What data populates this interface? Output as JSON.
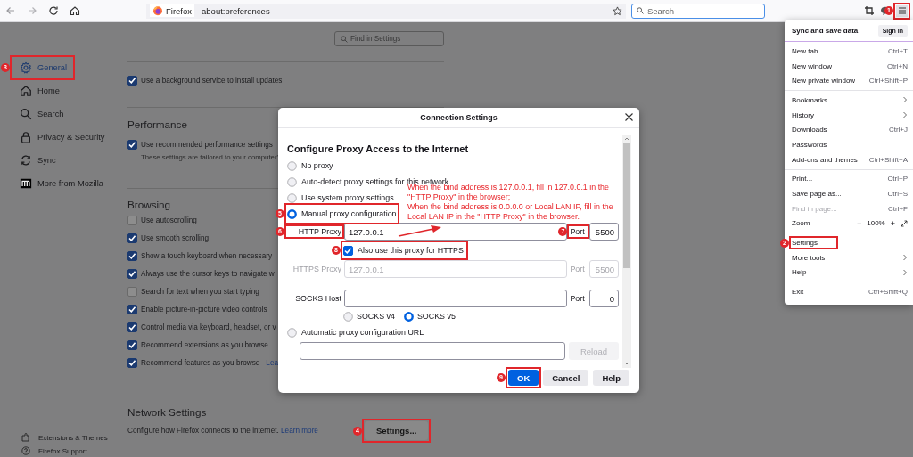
{
  "toolbar": {
    "site_label": "Firefox",
    "url": "about:preferences",
    "search": {
      "placeholder": "Search"
    },
    "menu_button": {
      "marker": "1"
    }
  },
  "find_field": {
    "placeholder": "Find in Settings"
  },
  "sidebar": {
    "items": [
      {
        "label": "General",
        "selected": true,
        "marker": "3"
      },
      {
        "label": "Home",
        "selected": false
      },
      {
        "label": "Search",
        "selected": false
      },
      {
        "label": "Privacy & Security",
        "selected": false
      },
      {
        "label": "Sync",
        "selected": false
      },
      {
        "label": "More from Mozilla",
        "selected": false
      }
    ],
    "footer_links": [
      "Extensions & Themes",
      "Firefox Support"
    ]
  },
  "content": {
    "update_option": {
      "label": "Use a background service to install updates",
      "checked": true
    },
    "performance": {
      "heading": "Performance",
      "option": {
        "label": "Use recommended performance settings",
        "checked": true
      },
      "note": "These settings are tailored to your computer'"
    },
    "browsing": {
      "heading": "Browsing",
      "options": [
        {
          "label": "Use autoscrolling",
          "checked": false
        },
        {
          "label": "Use smooth scrolling",
          "checked": true
        },
        {
          "label": "Show a touch keyboard when necessary",
          "checked": true
        },
        {
          "label": "Always use the cursor keys to navigate w",
          "checked": true
        },
        {
          "label": "Search for text when you start typing",
          "checked": false
        },
        {
          "label": "Enable picture-in-picture video controls",
          "checked": true
        },
        {
          "label": "Control media via keyboard, headset, or v",
          "checked": true
        },
        {
          "label": "Recommend extensions as you browse",
          "checked": true
        },
        {
          "label": "Recommend features as you browse",
          "checked": true,
          "link": "Lea"
        }
      ]
    },
    "network": {
      "heading": "Network Settings",
      "description": "Configure how Firefox connects to the internet.",
      "link": "Learn more",
      "button": {
        "label": "Settings...",
        "marker": "4"
      }
    }
  },
  "dialog": {
    "title": "Connection Settings",
    "heading": "Configure Proxy Access to the Internet",
    "proxy_modes": [
      {
        "label": "No proxy",
        "selected": false
      },
      {
        "label": "Auto-detect proxy settings for this network",
        "selected": false
      },
      {
        "label": "Use system proxy settings",
        "selected": false
      },
      {
        "label": "Manual proxy configuration",
        "selected": true,
        "marker": "5"
      }
    ],
    "http_proxy": {
      "label": "HTTP Proxy",
      "value": "127.0.0.1",
      "marker": "6",
      "port_label": "Port",
      "port": "5500",
      "port_marker": "7"
    },
    "https_checkbox": {
      "label": "Also use this proxy for HTTPS",
      "checked": true,
      "marker": "8"
    },
    "https_proxy": {
      "label": "HTTPS Proxy",
      "value": "127.0.0.1",
      "port_label": "Port",
      "port": "5500",
      "disabled": true
    },
    "socks": {
      "label": "SOCKS Host",
      "port_label": "Port",
      "port": "0",
      "versions": [
        {
          "label": "SOCKS v4",
          "selected": false
        },
        {
          "label": "SOCKS v5",
          "selected": true
        }
      ]
    },
    "auto_url": {
      "label": "Automatic proxy configuration URL",
      "selected": false,
      "reload": {
        "label": "Reload",
        "disabled": true
      }
    },
    "buttons": [
      {
        "label": "OK",
        "kind": "primary",
        "marker": "9"
      },
      {
        "label": "Cancel",
        "kind": "secondary"
      },
      {
        "label": "Help",
        "kind": "secondary"
      }
    ]
  },
  "annotation": {
    "lines": [
      "When the bind address is 127.0.0.1, fill in 127.0.0.1 in the \"HTTP Proxy\" in the browser;",
      "When the bind address is 0.0.0.0 or Local LAN IP, fill in the Local LAN IP in the \"HTTP Proxy\" in the browser."
    ]
  },
  "menu": {
    "header": {
      "title": "Sync and save data",
      "button": "Sign In"
    },
    "groups": [
      {
        "items": [
          {
            "kind": "shortcut",
            "label": "New tab",
            "shortcut": "Ctrl+T",
            "disabled": false
          },
          {
            "kind": "shortcut",
            "label": "New window",
            "shortcut": "Ctrl+N",
            "disabled": false
          },
          {
            "kind": "shortcut",
            "label": "New private window",
            "shortcut": "Ctrl+Shift+P",
            "disabled": false
          }
        ]
      },
      {
        "items": [
          {
            "kind": "submenu",
            "label": "Bookmarks",
            "disabled": false
          },
          {
            "kind": "submenu",
            "label": "History",
            "disabled": false
          },
          {
            "kind": "shortcut",
            "label": "Downloads",
            "shortcut": "Ctrl+J",
            "disabled": false
          },
          {
            "kind": "plain",
            "label": "Passwords",
            "disabled": false
          },
          {
            "kind": "shortcut",
            "label": "Add-ons and themes",
            "shortcut": "Ctrl+Shift+A",
            "disabled": false
          }
        ]
      },
      {
        "items": [
          {
            "kind": "shortcut",
            "label": "Print...",
            "shortcut": "Ctrl+P",
            "disabled": false
          },
          {
            "kind": "shortcut",
            "label": "Save page as...",
            "shortcut": "Ctrl+S",
            "disabled": false
          },
          {
            "kind": "shortcut",
            "label": "Find in page...",
            "shortcut": "Ctrl+F",
            "disabled": true
          },
          {
            "kind": "zoom",
            "label": "Zoom",
            "minus": "−",
            "value": "100%",
            "plus": "+",
            "disabled": false
          }
        ]
      },
      {
        "items": [
          {
            "kind": "plain",
            "label": "Settings",
            "marker": "2",
            "disabled": false
          },
          {
            "kind": "submenu",
            "label": "More tools",
            "disabled": false
          },
          {
            "kind": "submenu",
            "label": "Help",
            "disabled": false
          }
        ]
      },
      {
        "items": [
          {
            "kind": "shortcut",
            "label": "Exit",
            "shortcut": "Ctrl+Shift+Q",
            "disabled": false
          }
        ]
      }
    ]
  }
}
